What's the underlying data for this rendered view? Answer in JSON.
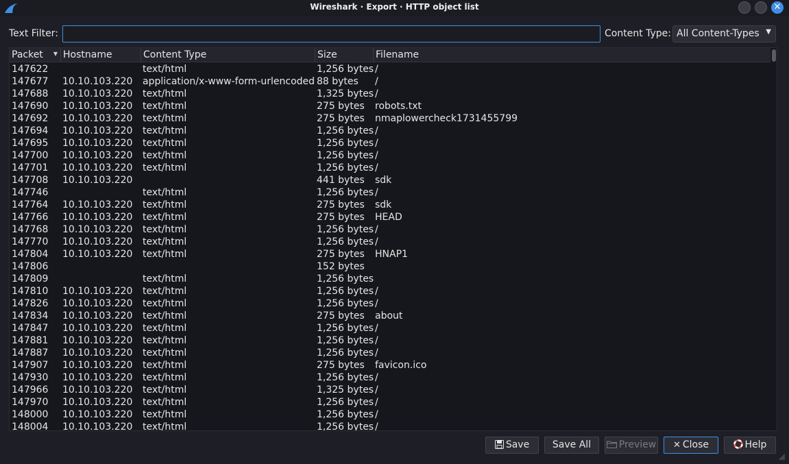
{
  "window": {
    "title": "Wireshark · Export · HTTP object list",
    "close_glyph": "✕"
  },
  "filter": {
    "label": "Text Filter:",
    "value": ""
  },
  "content_type": {
    "label": "Content Type:",
    "selected": "All Content-Types",
    "arrow": "▼"
  },
  "table": {
    "sort_glyph": "▼",
    "columns": [
      "Packet",
      "Hostname",
      "Content Type",
      "Size",
      "Filename"
    ],
    "rows": [
      [
        "147622",
        "",
        "text/html",
        "1,256 bytes",
        "/"
      ],
      [
        "147677",
        "10.10.103.220",
        "application/x-www-form-urlencoded",
        "88 bytes",
        "/"
      ],
      [
        "147688",
        "10.10.103.220",
        "text/html",
        "1,325 bytes",
        "/"
      ],
      [
        "147690",
        "10.10.103.220",
        "text/html",
        "275 bytes",
        "robots.txt"
      ],
      [
        "147692",
        "10.10.103.220",
        "text/html",
        "275 bytes",
        "nmaplowercheck1731455799"
      ],
      [
        "147694",
        "10.10.103.220",
        "text/html",
        "1,256 bytes",
        "/"
      ],
      [
        "147695",
        "10.10.103.220",
        "text/html",
        "1,256 bytes",
        "/"
      ],
      [
        "147700",
        "10.10.103.220",
        "text/html",
        "1,256 bytes",
        "/"
      ],
      [
        "147701",
        "10.10.103.220",
        "text/html",
        "1,256 bytes",
        "/"
      ],
      [
        "147708",
        "10.10.103.220",
        "",
        "441 bytes",
        "sdk"
      ],
      [
        "147746",
        "",
        "text/html",
        "1,256 bytes",
        "/"
      ],
      [
        "147764",
        "10.10.103.220",
        "text/html",
        "275 bytes",
        "sdk"
      ],
      [
        "147766",
        "10.10.103.220",
        "text/html",
        "275 bytes",
        "HEAD"
      ],
      [
        "147768",
        "10.10.103.220",
        "text/html",
        "1,256 bytes",
        "/"
      ],
      [
        "147770",
        "10.10.103.220",
        "text/html",
        "1,256 bytes",
        "/"
      ],
      [
        "147804",
        "10.10.103.220",
        "text/html",
        "275 bytes",
        "HNAP1"
      ],
      [
        "147806",
        "",
        "",
        "152 bytes",
        ""
      ],
      [
        "147809",
        "",
        "text/html",
        "1,256 bytes",
        ""
      ],
      [
        "147810",
        "10.10.103.220",
        "text/html",
        "1,256 bytes",
        "/"
      ],
      [
        "147826",
        "10.10.103.220",
        "text/html",
        "1,256 bytes",
        "/"
      ],
      [
        "147834",
        "10.10.103.220",
        "text/html",
        "275 bytes",
        "about"
      ],
      [
        "147847",
        "10.10.103.220",
        "text/html",
        "1,256 bytes",
        "/"
      ],
      [
        "147881",
        "10.10.103.220",
        "text/html",
        "1,256 bytes",
        "/"
      ],
      [
        "147887",
        "10.10.103.220",
        "text/html",
        "1,256 bytes",
        "/"
      ],
      [
        "147907",
        "10.10.103.220",
        "text/html",
        "275 bytes",
        "favicon.ico"
      ],
      [
        "147930",
        "10.10.103.220",
        "text/html",
        "1,256 bytes",
        "/"
      ],
      [
        "147966",
        "10.10.103.220",
        "text/html",
        "1,325 bytes",
        "/"
      ],
      [
        "147970",
        "10.10.103.220",
        "text/html",
        "1,256 bytes",
        "/"
      ],
      [
        "148000",
        "10.10.103.220",
        "text/html",
        "1,256 bytes",
        "/"
      ],
      [
        "148004",
        "10.10.103.220",
        "text/html",
        "1,256 bytes",
        "/"
      ]
    ]
  },
  "buttons": {
    "save": "Save",
    "save_all": "Save All",
    "preview": "Preview",
    "close": "Close",
    "close_glyph": "✕",
    "help": "Help"
  },
  "colors": {
    "accent": "#3f8fe6",
    "background": "#1e1f26",
    "table_background": "#16171c"
  }
}
